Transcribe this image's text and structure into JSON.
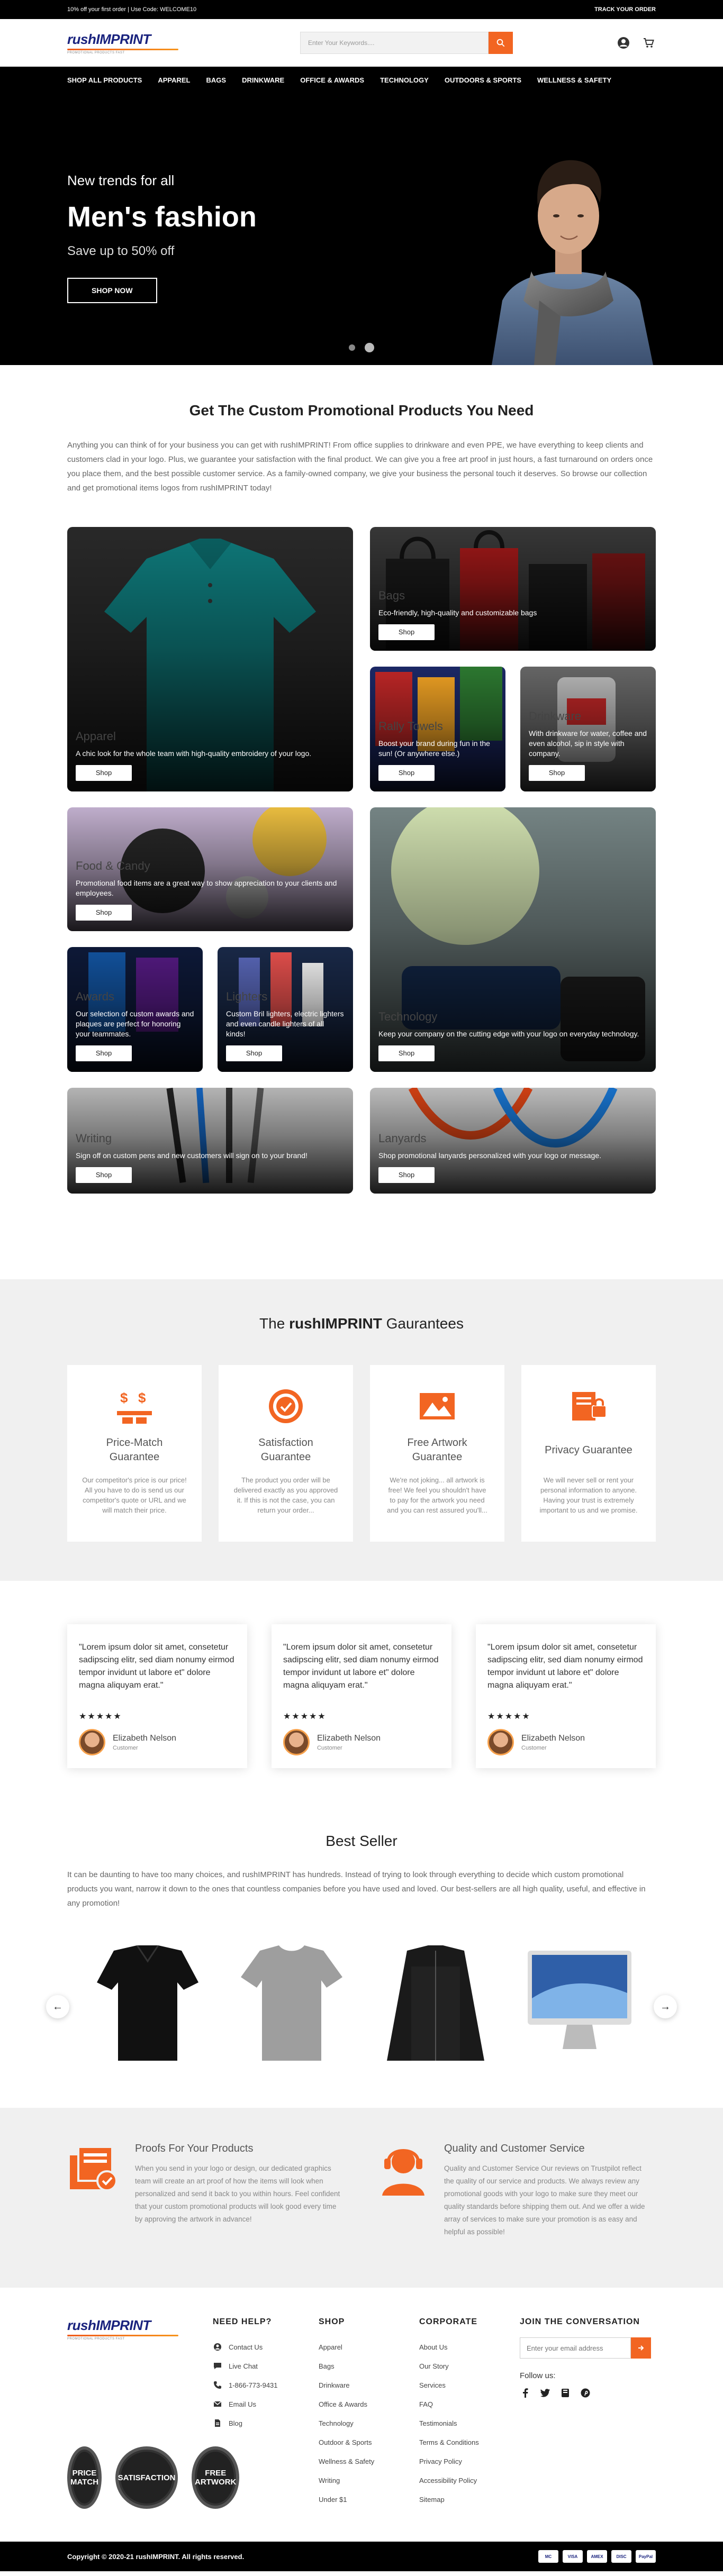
{
  "topbar": {
    "promo": "10% off your first order | Use Code: WELCOME10",
    "track": "TRACK YOUR ORDER"
  },
  "header": {
    "logo_rush": "rush",
    "logo_imprint": "IMPRINT",
    "logo_tagline": "PROMOTIONAL PRODUCTS FAST",
    "search_placeholder": "Enter Your Keywords....",
    "icons": [
      "search-icon",
      "user-icon",
      "cart-icon"
    ]
  },
  "nav": [
    "SHOP ALL PRODUCTS",
    "APPAREL",
    "BAGS",
    "DRINKWARE",
    "OFFICE & AWARDS",
    "TECHNOLOGY",
    "OUTDOORS & SPORTS",
    "WELLNESS & SAFETY"
  ],
  "hero": {
    "kicker": "New trends for all",
    "title": "Men's fashion",
    "subtitle": "Save up to 50% off",
    "button": "SHOP NOW",
    "slides": 2,
    "active_slide": 2
  },
  "categories": {
    "title": "Get The Custom Promotional Products You Need",
    "intro": "Anything you can think of for your business you can get with rushIMPRINT! From office supplies to drinkware and even PPE, we have everything to keep clients and customers clad in your logo. Plus, we guarantee your satisfaction with the final product. We can give you a free art proof in just hours, a fast turnaround on orders once you place them, and the best possible customer service. As a family-owned company, we give your business the personal touch it deserves. So browse our collection and get promotional items logos from rushIMPRINT today!",
    "button": "Shop",
    "tiles": [
      {
        "name": "Apparel",
        "desc": "A chic look for the whole team with high-quality embroidery of your logo."
      },
      {
        "name": "Bags",
        "desc": "Eco-friendly, high-quality and customizable bags"
      },
      {
        "name": "Rally Towels",
        "desc": "Boost your brand during fun in the sun! (Or anywhere else.)"
      },
      {
        "name": "Drinkware",
        "desc": "With drinkware for water, coffee and even alcohol, sip in style with company."
      },
      {
        "name": "Food & Candy",
        "desc": "Promotional food items are a great way to show appreciation to your clients and employees."
      },
      {
        "name": "Technology",
        "desc": "Keep your company on the cutting edge with your logo on everyday technology."
      },
      {
        "name": "Awards",
        "desc": "Our selection of custom awards and plaques are perfect for honoring your teammates."
      },
      {
        "name": "Lighters",
        "desc": "Custom Bril lighters, electric lighters and even candle lighters of all kinds!"
      },
      {
        "name": "Writing",
        "desc": "Sign off on custom pens and new customers will sign on to your brand!"
      },
      {
        "name": "Lanyards",
        "desc": "Shop promotional lanyards personalized with your logo or message."
      }
    ]
  },
  "guarantees": {
    "title_prefix": "The ",
    "title_brand": "rushIMPRINT",
    "title_suffix": " Gaurantees",
    "accent": "#f26522",
    "items": [
      {
        "title": "Price-Match Guarantee",
        "text": "Our competitor's price is our price! All you have to do is send us our competitor's quote or URL and we will match their price.",
        "icon": "price-match-icon"
      },
      {
        "title": "Satisfaction Guarantee",
        "text": "The product you order will be delivered exactly as you approved it. If this is not the case, you can return your order...",
        "icon": "satisfaction-badge-icon"
      },
      {
        "title": "Free Artwork Guarantee",
        "text": "We're not joking... all artwork is free! We feel you shouldn't have to pay for the artwork you need and you can rest assured you'll...",
        "icon": "artwork-icon"
      },
      {
        "title": "Privacy Guarantee",
        "text": "We will never sell or rent your personal information to anyone. Having your trust is extremely important to us and we promise.",
        "icon": "privacy-icon"
      }
    ]
  },
  "testimonials": [
    {
      "quote": "\"Lorem ipsum dolor sit amet, consetetur sadipscing elitr, sed diam nonumy eirmod tempor invidunt ut labore et\" dolore magna aliquyam erat.\"",
      "stars": "★★★★★",
      "name": "Elizabeth Nelson",
      "role": "Customer"
    },
    {
      "quote": "\"Lorem ipsum dolor sit amet, consetetur sadipscing elitr, sed diam nonumy eirmod tempor invidunt ut labore et\" dolore magna aliquyam erat.\"",
      "stars": "★★★★★",
      "name": "Elizabeth Nelson",
      "role": "Customer"
    },
    {
      "quote": "\"Lorem ipsum dolor sit amet, consetetur sadipscing elitr, sed diam nonumy eirmod tempor invidunt ut labore et\" dolore magna aliquyam erat.\"",
      "stars": "★★★★★",
      "name": "Elizabeth Nelson",
      "role": "Customer"
    }
  ],
  "bestseller": {
    "title": "Best Seller",
    "intro": "It can be daunting to have too many choices, and rushIMPRINT has hundreds. Instead of trying to look through everything to decide which custom promotional products you want, narrow it down to the ones that countless companies before you have used and loved. Our best-sellers are all high quality, useful, and effective in any promotion!",
    "prev": "←",
    "next": "→",
    "products": [
      "womens-polo-black",
      "tshirt-gray",
      "leather-jacket-black",
      "imac-monitor"
    ]
  },
  "proofs": [
    {
      "title": "Proofs For Your Products",
      "text": "When you send in your logo or design, our dedicated graphics team will create an art proof of how the items will look when personalized and send it back to you within hours. Feel confident that your custom promotional products will look good every time by approving the artwork in advance!",
      "icon": "proof-layers-icon"
    },
    {
      "title": "Quality and Customer Service",
      "text": "Quality and Customer Service Our reviews on Trustpilot reflect the quality of our service and products. We always review any promotional goods with your logo to make sure they meet our quality standards before shipping them out. And we offer a wide array of services to make sure your promotion is as easy and helpful as possible!",
      "icon": "headset-agent-icon"
    }
  ],
  "footer": {
    "need_help": {
      "title": "NEED HELP?",
      "items": [
        {
          "label": "Contact Us",
          "icon": "contact-icon"
        },
        {
          "label": "Live Chat",
          "icon": "chat-icon"
        },
        {
          "label": "1-866-773-9431",
          "icon": "phone-icon"
        },
        {
          "label": "Email Us",
          "icon": "email-icon"
        },
        {
          "label": "Blog",
          "icon": "blog-icon"
        }
      ]
    },
    "shop": {
      "title": "SHOP",
      "items": [
        "Apparel",
        "Bags",
        "Drinkware",
        "Office & Awards",
        "Technology",
        "Outdoor & Sports",
        "Wellness & Safety",
        "Writing",
        "Under $1"
      ]
    },
    "corporate": {
      "title": "CORPORATE",
      "items": [
        "About Us",
        "Our Story",
        "Services",
        "FAQ",
        "Testimonials",
        "Terms & Conditions",
        "Privacy Policy",
        "Accessibility Policy",
        "Sitemap"
      ]
    },
    "join": {
      "title": "JOIN THE CONVERSATION",
      "placeholder": "Enter your email address",
      "follow": "Follow us:",
      "socials": [
        "facebook-icon",
        "twitter-icon",
        "instagram-icon",
        "pinterest-icon"
      ]
    },
    "badges": [
      "PRICE MATCH",
      "SATISFACTION",
      "FREE ARTWORK"
    ]
  },
  "copyright": {
    "text": "Copyright © 2020-21 rushIMPRINT. All rights reserved.",
    "payments": [
      "MC",
      "VISA",
      "AMEX",
      "DISC",
      "PayPal"
    ]
  }
}
